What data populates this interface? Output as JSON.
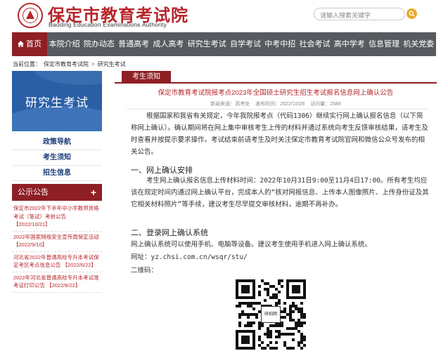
{
  "header": {
    "logo_cn": "保定市教育考试院",
    "logo_en": "Baoding Education Examinations Authority",
    "search_placeholder": "请输入搜索关键字"
  },
  "nav": {
    "items": [
      "首页",
      "本院介绍",
      "院办动态",
      "普通高考",
      "成人高考",
      "研究生考试",
      "自学考试",
      "中考中招",
      "社会考试",
      "高中学考",
      "信息管理",
      "机关党委"
    ],
    "active_index": 0
  },
  "breadcrumb": {
    "prefix": "当前位置：",
    "items": [
      "保定市教育考试院",
      "研究生考试"
    ],
    "separator": ">"
  },
  "sidebar": {
    "banner_title": "研究生考试",
    "links": [
      "政策导航",
      "考生须知",
      "招生信息"
    ],
    "notice": {
      "title": "公示公告",
      "plus": "+",
      "items": [
        {
          "text": "保定市2022年下半年中小学教师资格考试（笔试）考前公告",
          "date": "【2022/10/21】"
        },
        {
          "text": "2022年国家网络安全宣传周保定活动",
          "date": "【2022/9/10】"
        },
        {
          "text": "河北省2022年普通高校专升本考试保定考区考点信息公告",
          "date": "【2022/6/22】"
        },
        {
          "text": "2022年河北省普通高校专升本考试准考证打印公告",
          "date": "【2022/6/22】"
        }
      ]
    }
  },
  "main": {
    "tab_label": "考生须知",
    "title": "保定市教育考试院报考点2023年全国硕士研究生招生考试报名信息网上确认公告",
    "meta": {
      "source": "新闻来源：高考处",
      "date": "发布时间：2022/10/26",
      "views": "访问量：2588"
    },
    "para1": "根据国家和我省有关规定，今年我院报考点（代码1306）继续实行网上确认报名信息（以下简称网上确认）。确认期间将在网上集中审核考生上传的材料并通过系统向考生反馈审核结果，请考生及时查看并按提示要求操作。考试结束前请考生及时关注保定市教育考试院官网和微信公众号发布的相关公告。",
    "heading1": "一、网上确认安排",
    "para2": "考生网上确认报名信息上传材料时间：2022年10月31日9:00至11月4日17:00。所有考生均应该在规定时间内通过网上确认平台，完成本人的“核对网报信息、上传本人图像照片、上传身份证及其它相关材料照片”等手续，建议考生尽早提交审核材料，逾期不再补办。",
    "heading2": "二、登录网上确认系统",
    "para3": "网上确认系统可以使用手机、电脑等设备。建议考生使用手机进入网上确认系统。",
    "url_line": "网址：yz.chsi.com.cn/wsqr/stu/",
    "qr_label": "二维码：",
    "qr_center": "研招网"
  },
  "colors": {
    "brand_red": "#8e1f24",
    "title_red": "#b8252b",
    "nav_gray": "#575a5f",
    "banner_blue": "#2a5ea5",
    "search_button": "#e9a92b"
  }
}
